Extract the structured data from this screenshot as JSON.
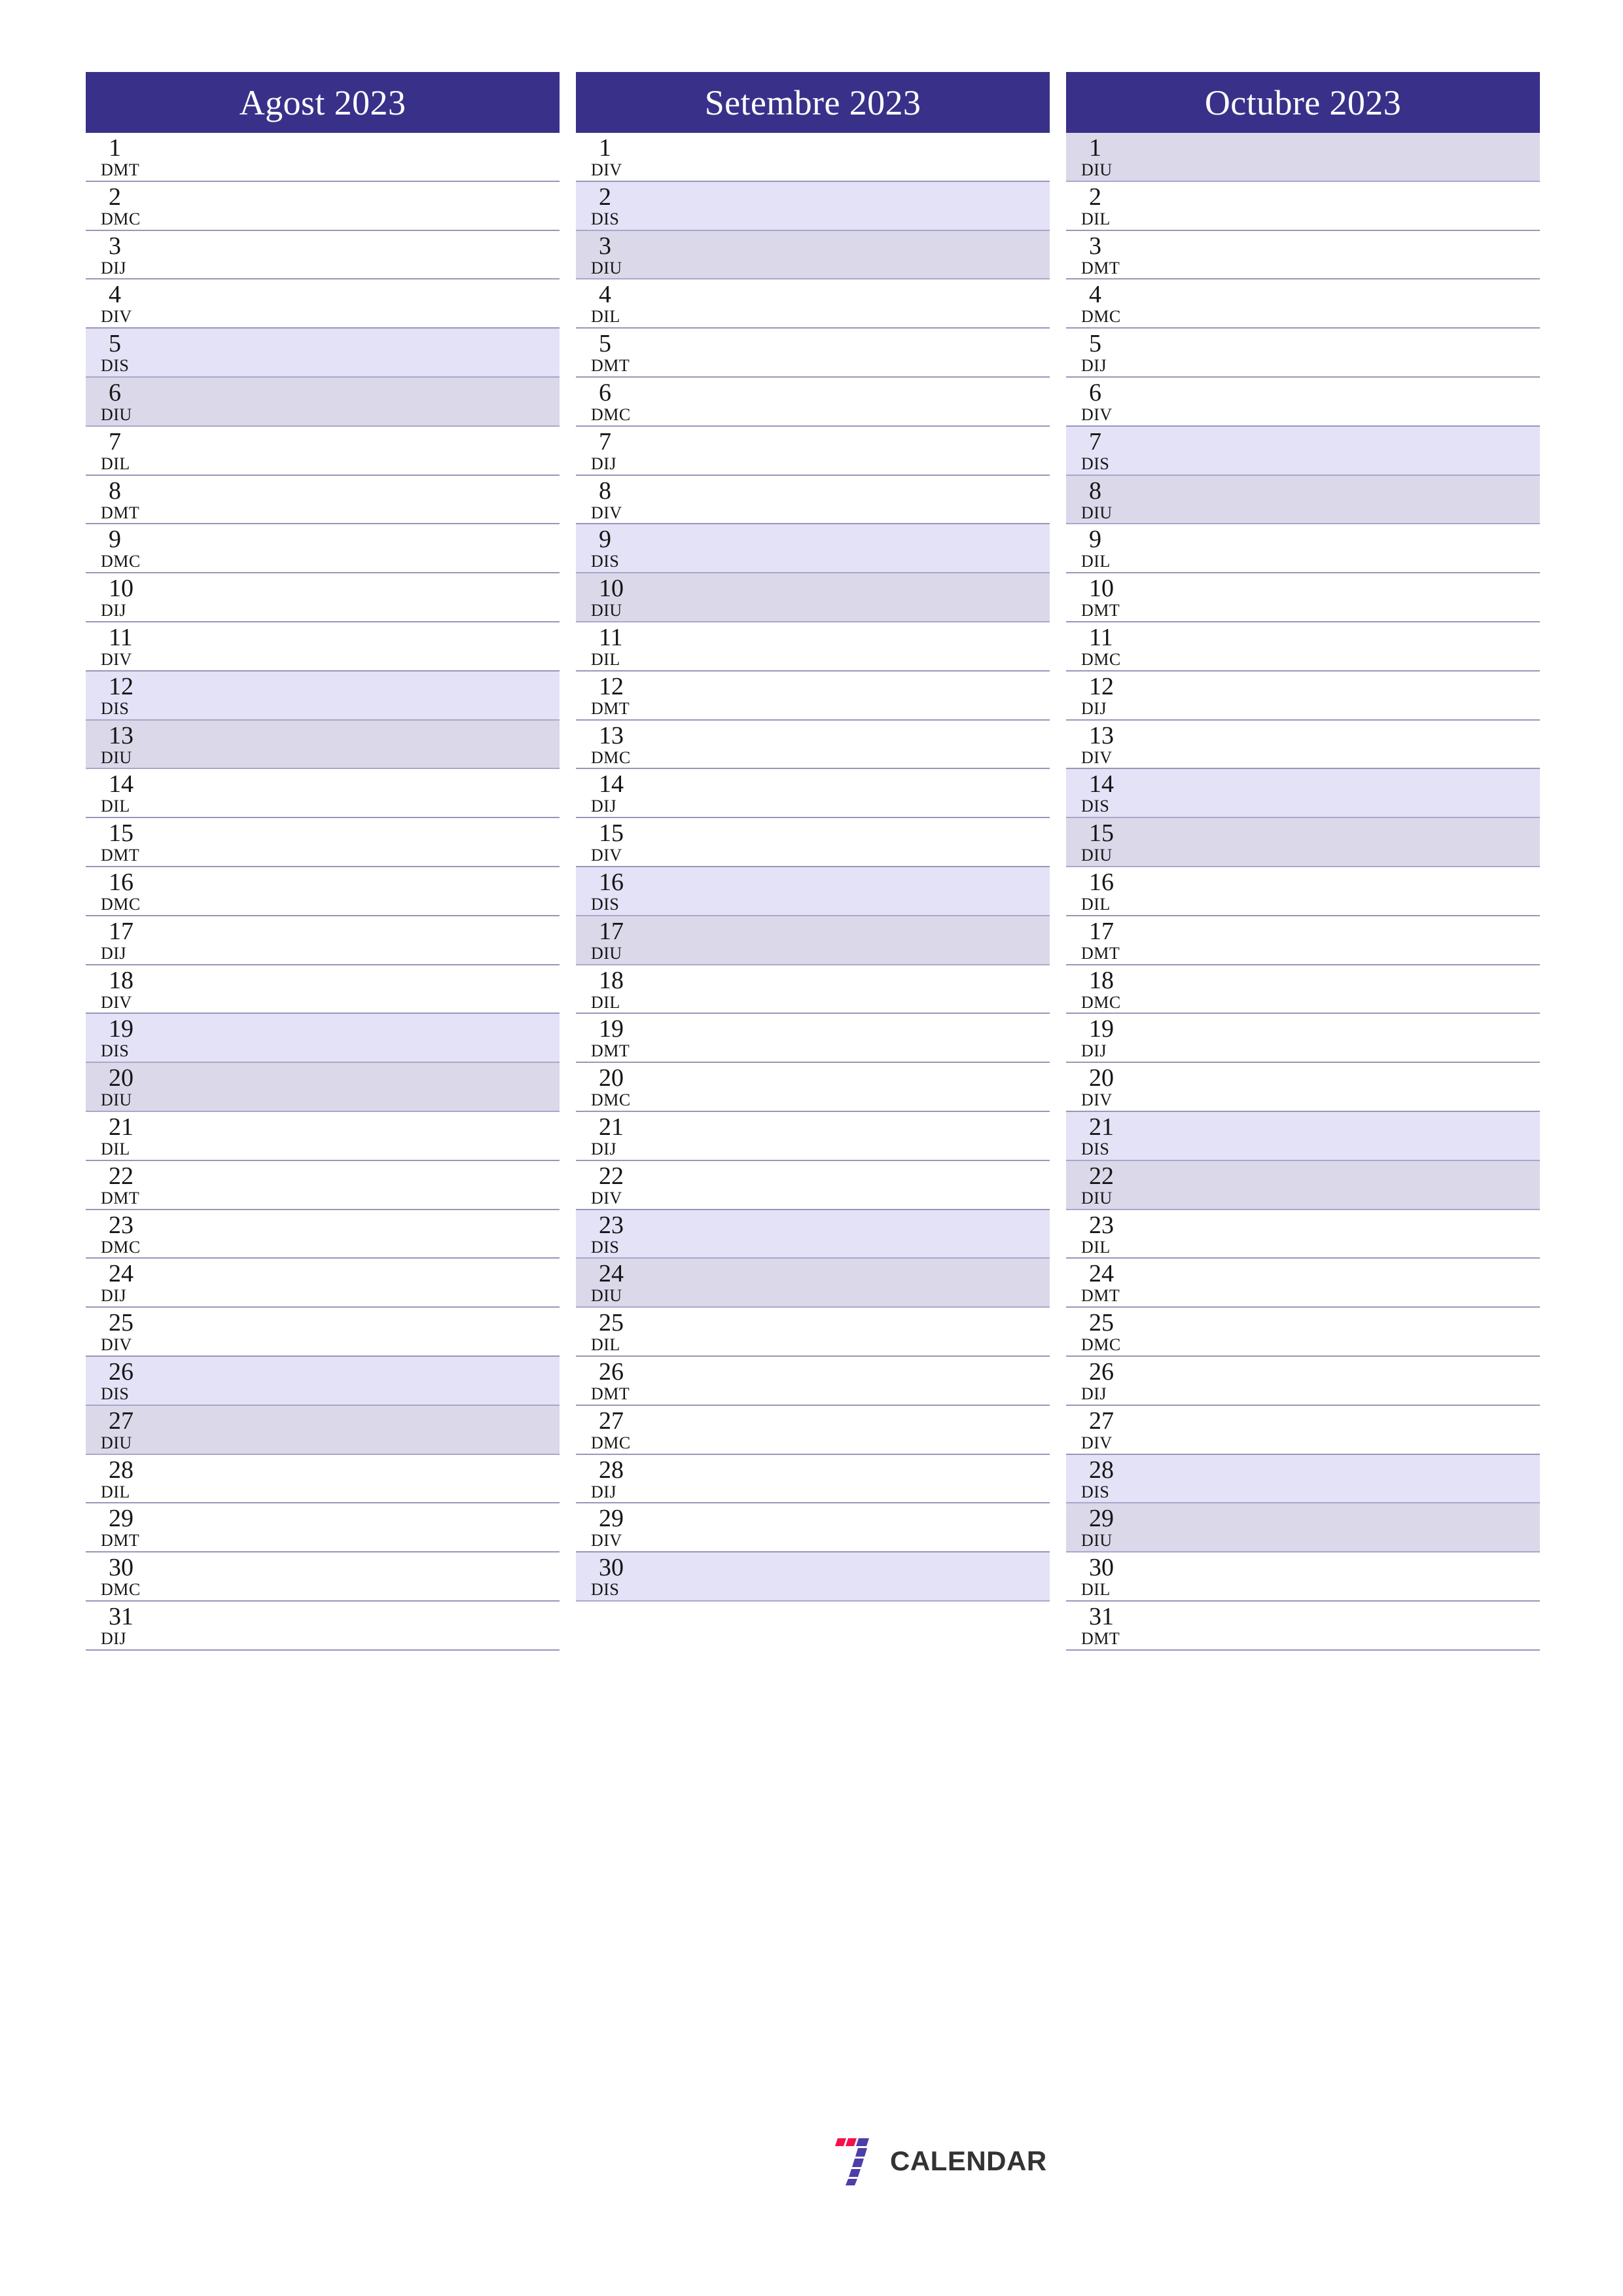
{
  "colors": {
    "header_bg": "#393189",
    "header_text": "#ffffff",
    "saturday_bg": "#e3e2f6",
    "sunday_bg": "#dbd8ea",
    "row_border": "#9897b8",
    "day_text": "#151515",
    "logo_red": "#f5114b",
    "logo_purple": "#4c3fa8",
    "logo_word": "#333333"
  },
  "logo": {
    "mark_name": "seven-logo-icon",
    "word": "CALENDAR"
  },
  "months": [
    {
      "title": "Agost 2023",
      "days": [
        {
          "num": "1",
          "abbr": "DMT",
          "type": "weekday"
        },
        {
          "num": "2",
          "abbr": "DMC",
          "type": "weekday"
        },
        {
          "num": "3",
          "abbr": "DIJ",
          "type": "weekday"
        },
        {
          "num": "4",
          "abbr": "DIV",
          "type": "weekday"
        },
        {
          "num": "5",
          "abbr": "DIS",
          "type": "saturday"
        },
        {
          "num": "6",
          "abbr": "DIU",
          "type": "sunday"
        },
        {
          "num": "7",
          "abbr": "DIL",
          "type": "weekday"
        },
        {
          "num": "8",
          "abbr": "DMT",
          "type": "weekday"
        },
        {
          "num": "9",
          "abbr": "DMC",
          "type": "weekday"
        },
        {
          "num": "10",
          "abbr": "DIJ",
          "type": "weekday"
        },
        {
          "num": "11",
          "abbr": "DIV",
          "type": "weekday"
        },
        {
          "num": "12",
          "abbr": "DIS",
          "type": "saturday"
        },
        {
          "num": "13",
          "abbr": "DIU",
          "type": "sunday"
        },
        {
          "num": "14",
          "abbr": "DIL",
          "type": "weekday"
        },
        {
          "num": "15",
          "abbr": "DMT",
          "type": "weekday"
        },
        {
          "num": "16",
          "abbr": "DMC",
          "type": "weekday"
        },
        {
          "num": "17",
          "abbr": "DIJ",
          "type": "weekday"
        },
        {
          "num": "18",
          "abbr": "DIV",
          "type": "weekday"
        },
        {
          "num": "19",
          "abbr": "DIS",
          "type": "saturday"
        },
        {
          "num": "20",
          "abbr": "DIU",
          "type": "sunday"
        },
        {
          "num": "21",
          "abbr": "DIL",
          "type": "weekday"
        },
        {
          "num": "22",
          "abbr": "DMT",
          "type": "weekday"
        },
        {
          "num": "23",
          "abbr": "DMC",
          "type": "weekday"
        },
        {
          "num": "24",
          "abbr": "DIJ",
          "type": "weekday"
        },
        {
          "num": "25",
          "abbr": "DIV",
          "type": "weekday"
        },
        {
          "num": "26",
          "abbr": "DIS",
          "type": "saturday"
        },
        {
          "num": "27",
          "abbr": "DIU",
          "type": "sunday"
        },
        {
          "num": "28",
          "abbr": "DIL",
          "type": "weekday"
        },
        {
          "num": "29",
          "abbr": "DMT",
          "type": "weekday"
        },
        {
          "num": "30",
          "abbr": "DMC",
          "type": "weekday"
        },
        {
          "num": "31",
          "abbr": "DIJ",
          "type": "weekday"
        }
      ]
    },
    {
      "title": "Setembre 2023",
      "days": [
        {
          "num": "1",
          "abbr": "DIV",
          "type": "weekday"
        },
        {
          "num": "2",
          "abbr": "DIS",
          "type": "saturday"
        },
        {
          "num": "3",
          "abbr": "DIU",
          "type": "sunday"
        },
        {
          "num": "4",
          "abbr": "DIL",
          "type": "weekday"
        },
        {
          "num": "5",
          "abbr": "DMT",
          "type": "weekday"
        },
        {
          "num": "6",
          "abbr": "DMC",
          "type": "weekday"
        },
        {
          "num": "7",
          "abbr": "DIJ",
          "type": "weekday"
        },
        {
          "num": "8",
          "abbr": "DIV",
          "type": "weekday"
        },
        {
          "num": "9",
          "abbr": "DIS",
          "type": "saturday"
        },
        {
          "num": "10",
          "abbr": "DIU",
          "type": "sunday"
        },
        {
          "num": "11",
          "abbr": "DIL",
          "type": "weekday"
        },
        {
          "num": "12",
          "abbr": "DMT",
          "type": "weekday"
        },
        {
          "num": "13",
          "abbr": "DMC",
          "type": "weekday"
        },
        {
          "num": "14",
          "abbr": "DIJ",
          "type": "weekday"
        },
        {
          "num": "15",
          "abbr": "DIV",
          "type": "weekday"
        },
        {
          "num": "16",
          "abbr": "DIS",
          "type": "saturday"
        },
        {
          "num": "17",
          "abbr": "DIU",
          "type": "sunday"
        },
        {
          "num": "18",
          "abbr": "DIL",
          "type": "weekday"
        },
        {
          "num": "19",
          "abbr": "DMT",
          "type": "weekday"
        },
        {
          "num": "20",
          "abbr": "DMC",
          "type": "weekday"
        },
        {
          "num": "21",
          "abbr": "DIJ",
          "type": "weekday"
        },
        {
          "num": "22",
          "abbr": "DIV",
          "type": "weekday"
        },
        {
          "num": "23",
          "abbr": "DIS",
          "type": "saturday"
        },
        {
          "num": "24",
          "abbr": "DIU",
          "type": "sunday"
        },
        {
          "num": "25",
          "abbr": "DIL",
          "type": "weekday"
        },
        {
          "num": "26",
          "abbr": "DMT",
          "type": "weekday"
        },
        {
          "num": "27",
          "abbr": "DMC",
          "type": "weekday"
        },
        {
          "num": "28",
          "abbr": "DIJ",
          "type": "weekday"
        },
        {
          "num": "29",
          "abbr": "DIV",
          "type": "weekday"
        },
        {
          "num": "30",
          "abbr": "DIS",
          "type": "saturday"
        }
      ]
    },
    {
      "title": "Octubre 2023",
      "days": [
        {
          "num": "1",
          "abbr": "DIU",
          "type": "sunday"
        },
        {
          "num": "2",
          "abbr": "DIL",
          "type": "weekday"
        },
        {
          "num": "3",
          "abbr": "DMT",
          "type": "weekday"
        },
        {
          "num": "4",
          "abbr": "DMC",
          "type": "weekday"
        },
        {
          "num": "5",
          "abbr": "DIJ",
          "type": "weekday"
        },
        {
          "num": "6",
          "abbr": "DIV",
          "type": "weekday"
        },
        {
          "num": "7",
          "abbr": "DIS",
          "type": "saturday"
        },
        {
          "num": "8",
          "abbr": "DIU",
          "type": "sunday"
        },
        {
          "num": "9",
          "abbr": "DIL",
          "type": "weekday"
        },
        {
          "num": "10",
          "abbr": "DMT",
          "type": "weekday"
        },
        {
          "num": "11",
          "abbr": "DMC",
          "type": "weekday"
        },
        {
          "num": "12",
          "abbr": "DIJ",
          "type": "weekday"
        },
        {
          "num": "13",
          "abbr": "DIV",
          "type": "weekday"
        },
        {
          "num": "14",
          "abbr": "DIS",
          "type": "saturday"
        },
        {
          "num": "15",
          "abbr": "DIU",
          "type": "sunday"
        },
        {
          "num": "16",
          "abbr": "DIL",
          "type": "weekday"
        },
        {
          "num": "17",
          "abbr": "DMT",
          "type": "weekday"
        },
        {
          "num": "18",
          "abbr": "DMC",
          "type": "weekday"
        },
        {
          "num": "19",
          "abbr": "DIJ",
          "type": "weekday"
        },
        {
          "num": "20",
          "abbr": "DIV",
          "type": "weekday"
        },
        {
          "num": "21",
          "abbr": "DIS",
          "type": "saturday"
        },
        {
          "num": "22",
          "abbr": "DIU",
          "type": "sunday"
        },
        {
          "num": "23",
          "abbr": "DIL",
          "type": "weekday"
        },
        {
          "num": "24",
          "abbr": "DMT",
          "type": "weekday"
        },
        {
          "num": "25",
          "abbr": "DMC",
          "type": "weekday"
        },
        {
          "num": "26",
          "abbr": "DIJ",
          "type": "weekday"
        },
        {
          "num": "27",
          "abbr": "DIV",
          "type": "weekday"
        },
        {
          "num": "28",
          "abbr": "DIS",
          "type": "saturday"
        },
        {
          "num": "29",
          "abbr": "DIU",
          "type": "sunday"
        },
        {
          "num": "30",
          "abbr": "DIL",
          "type": "weekday"
        },
        {
          "num": "31",
          "abbr": "DMT",
          "type": "weekday"
        }
      ]
    }
  ]
}
